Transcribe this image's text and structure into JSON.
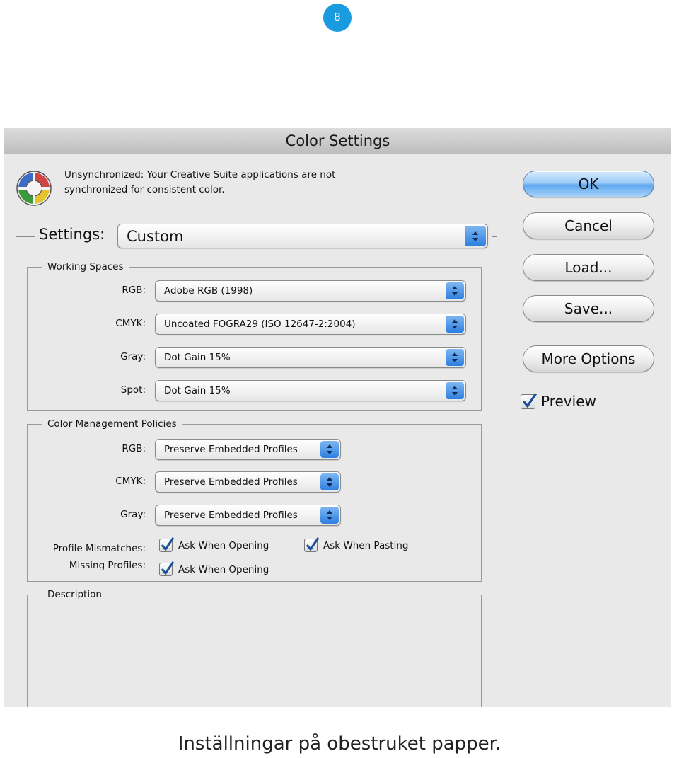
{
  "step_number": "8",
  "window": {
    "title": "Color Settings"
  },
  "sync": {
    "line1": "Unsynchronized: Your Creative Suite applications are not",
    "line2": "synchronized for consistent color."
  },
  "settings": {
    "label": "Settings:",
    "value": "Custom"
  },
  "working_spaces": {
    "title": "Working Spaces",
    "rows": [
      {
        "label": "RGB:",
        "value": "Adobe RGB (1998)"
      },
      {
        "label": "CMYK:",
        "value": "Uncoated FOGRA29 (ISO 12647-2:2004)"
      },
      {
        "label": "Gray:",
        "value": "Dot Gain 15%"
      },
      {
        "label": "Spot:",
        "value": "Dot Gain 15%"
      }
    ]
  },
  "policies": {
    "title": "Color Management Policies",
    "rows": [
      {
        "label": "RGB:",
        "value": "Preserve Embedded Profiles"
      },
      {
        "label": "CMYK:",
        "value": "Preserve Embedded Profiles"
      },
      {
        "label": "Gray:",
        "value": "Preserve Embedded Profiles"
      }
    ],
    "profile_mismatches_label": "Profile Mismatches:",
    "missing_profiles_label": "Missing Profiles:",
    "mismatch_opening": "Ask When Opening",
    "mismatch_pasting": "Ask When Pasting",
    "missing_opening": "Ask When Opening"
  },
  "description": {
    "title": "Description"
  },
  "buttons": {
    "ok": "OK",
    "cancel": "Cancel",
    "load": "Load...",
    "save": "Save...",
    "more_options": "More Options"
  },
  "preview": {
    "label": "Preview",
    "checked": true
  },
  "caption": "Inställningar på obestruket papper.",
  "colors": {
    "badge": "#1a9be0",
    "accent_blue": "#2d7fe0",
    "dialog_bg": "#e9e9e9"
  }
}
